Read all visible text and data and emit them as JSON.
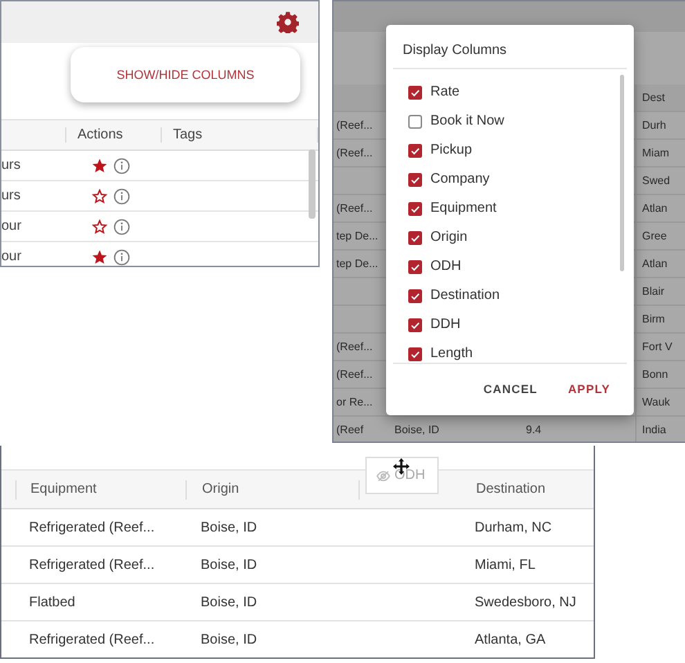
{
  "loads_panel": {
    "button": "SHOW/HIDE COLUMNS",
    "columns": [
      "Actions",
      "Tags"
    ],
    "rows": [
      {
        "column_1": "urs",
        "starred": true
      },
      {
        "column_1": "urs",
        "starred": false
      },
      {
        "column_1": "our",
        "starred": false
      },
      {
        "column_1": "our",
        "starred": true
      }
    ]
  },
  "columns_panel": {
    "background_table": {
      "header": "Dest",
      "rows": [
        {
          "column_1": "(Reef...",
          "column_4": "Durh"
        },
        {
          "column_1": "(Reef...",
          "column_4": "Miam"
        },
        {
          "column_4": "Swed"
        },
        {
          "column_1": "(Reef...",
          "column_4": "Atlan"
        },
        {
          "column_1": "tep De...",
          "column_4": "Gree"
        },
        {
          "column_1": "tep De...",
          "column_4": "Atlan"
        },
        {
          "column_4": "Blair"
        },
        {
          "column_4": "Birm"
        },
        {
          "column_1": "(Reef...",
          "column_4": "Fort V"
        },
        {
          "column_1": "(Reef...",
          "column_4": "Bonn"
        },
        {
          "column_1": "or Re...",
          "column_4": "Wauk"
        },
        {
          "column_1": "(Reef",
          "column_2": "Boise, ID",
          "column_3": "9.4",
          "column_4": "India"
        }
      ]
    },
    "dialog": {
      "title": "Display Columns",
      "options": [
        {
          "label": "Rate",
          "checked": true
        },
        {
          "label": "Book it Now",
          "checked": false
        },
        {
          "label": "Pickup",
          "checked": true
        },
        {
          "label": "Company",
          "checked": true
        },
        {
          "label": "Equipment",
          "checked": true
        },
        {
          "label": "Origin",
          "checked": true
        },
        {
          "label": "ODH",
          "checked": true
        },
        {
          "label": "Destination",
          "checked": true
        },
        {
          "label": "DDH",
          "checked": true
        },
        {
          "label": "Length",
          "checked": true
        }
      ],
      "buttons": [
        {
          "label": "CANCEL",
          "kind": "secondary"
        },
        {
          "label": "APPLY",
          "kind": "primary"
        }
      ]
    }
  },
  "drag_panel": {
    "columns": [
      "Equipment",
      "Origin",
      "Destination"
    ],
    "dragged_column": "ODH",
    "rows": [
      [
        "Refrigerated (Reef...",
        "Boise, ID",
        "Durham, NC"
      ],
      [
        "Refrigerated (Reef...",
        "Boise, ID",
        "Miami, FL"
      ],
      [
        "Flatbed",
        "Boise, ID",
        "Swedesboro, NJ"
      ],
      [
        "Refrigerated (Reef...",
        "Boise, ID",
        "Atlanta, GA"
      ]
    ]
  }
}
